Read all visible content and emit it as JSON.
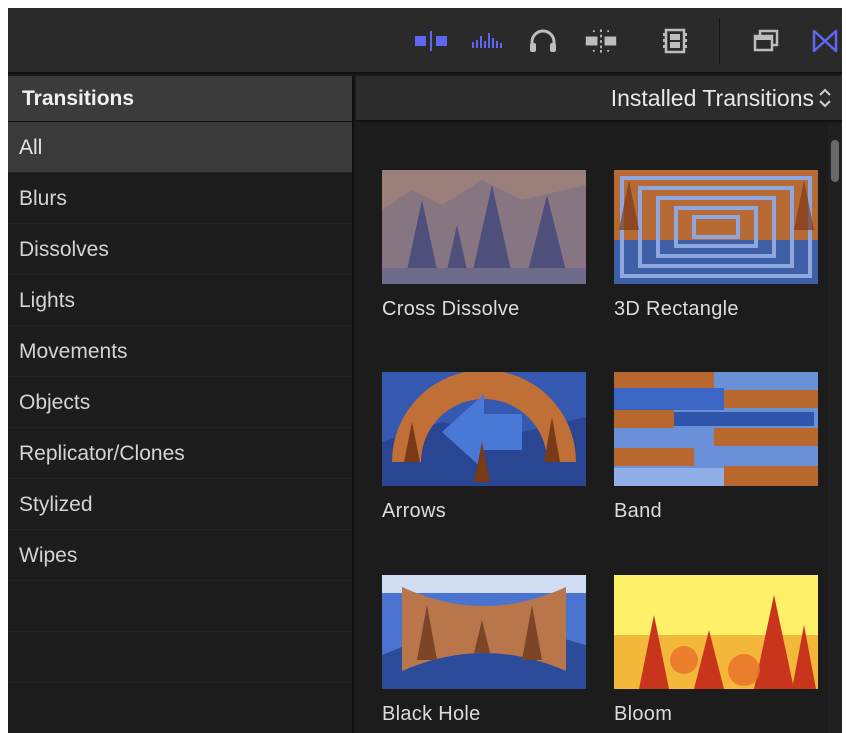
{
  "toolbar": {
    "icons": [
      "clip-appearance-icon",
      "audio-waveform-icon",
      "headphones-icon",
      "skimming-icon",
      "filmstrip-icon",
      "window-layout-icon",
      "transitions-browser-icon"
    ],
    "accent_color": "#5f66f2"
  },
  "sidebar": {
    "header": "Transitions",
    "items": [
      {
        "label": "All",
        "selected": true
      },
      {
        "label": "Blurs"
      },
      {
        "label": "Dissolves"
      },
      {
        "label": "Lights"
      },
      {
        "label": "Movements"
      },
      {
        "label": "Objects"
      },
      {
        "label": "Replicator/Clones"
      },
      {
        "label": "Stylized"
      },
      {
        "label": "Wipes"
      }
    ]
  },
  "main": {
    "selector_label": "Installed Transitions",
    "tiles": [
      {
        "label": "Cross Dissolve"
      },
      {
        "label": "3D Rectangle"
      },
      {
        "label": "Arrows"
      },
      {
        "label": "Band"
      },
      {
        "label": "Black Hole"
      },
      {
        "label": "Bloom"
      }
    ]
  }
}
